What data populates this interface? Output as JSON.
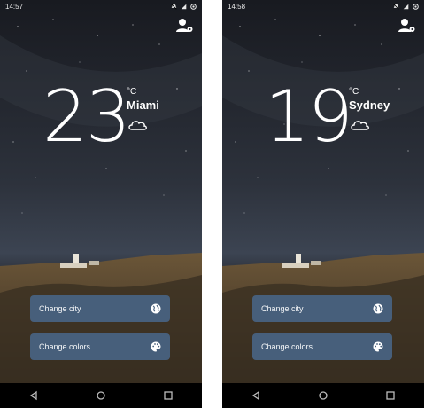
{
  "screens": [
    {
      "status": {
        "time": "14:57"
      },
      "weather": {
        "temperature": "23",
        "unit": "°C",
        "city": "Miami",
        "condition_icon": "cloud-icon"
      },
      "actions": {
        "change_city": "Change city",
        "change_colors": "Change colors"
      }
    },
    {
      "status": {
        "time": "14:58"
      },
      "weather": {
        "temperature": "19",
        "unit": "°C",
        "city": "Sydney",
        "condition_icon": "cloud-icon"
      },
      "actions": {
        "change_city": "Change city",
        "change_colors": "Change colors"
      }
    }
  ],
  "theme": {
    "button_color": "#475f7b",
    "sky_top": "#1b1d24",
    "sky_bottom": "#2a2e38",
    "rock": "#5a4630"
  }
}
